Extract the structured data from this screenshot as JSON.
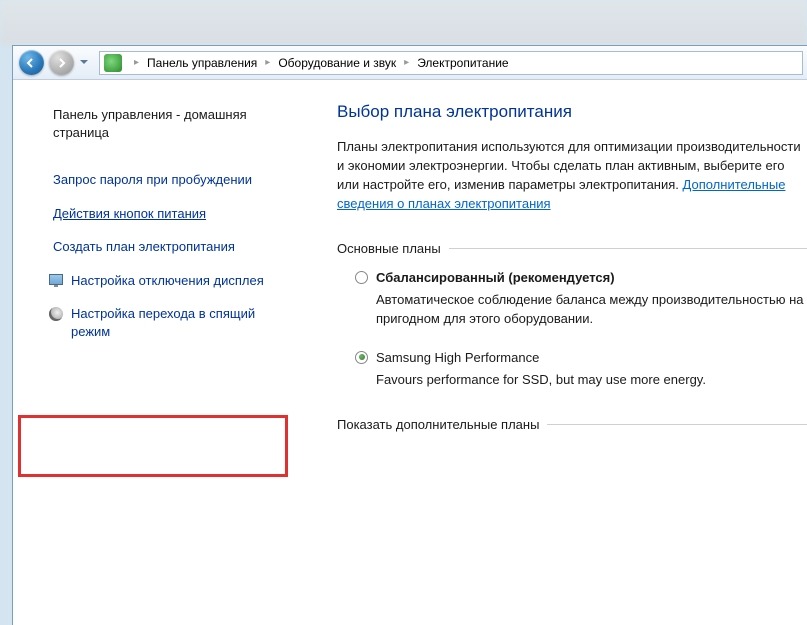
{
  "breadcrumb": {
    "parts": [
      "Панель управления",
      "Оборудование и звук",
      "Электропитание"
    ]
  },
  "sidebar": {
    "home": "Панель управления - домашняя страница",
    "items": [
      {
        "label": "Запрос пароля при пробуждении"
      },
      {
        "label": "Действия кнопок питания"
      },
      {
        "label": "Создать план электропитания"
      },
      {
        "label": "Настройка отключения дисплея"
      },
      {
        "label": "Настройка перехода в спящий режим"
      }
    ]
  },
  "main": {
    "title": "Выбор плана электропитания",
    "desc_part1": "Планы электропитания используются для оптимизации производительности и экономии электроэнергии. Чтобы сделать план активным, выберите его или настройте его, изменив параметры электропитания. ",
    "desc_link": "Дополнительные сведения о планах электропитания",
    "section1_label": "Основные планы",
    "plan1": {
      "name": "Сбалансированный (рекомендуется)",
      "desc": "Автоматическое соблюдение баланса между производительностью на пригодном для этого оборудовании."
    },
    "plan2": {
      "name": "Samsung High Performance",
      "desc": "Favours performance for SSD, but may use more energy."
    },
    "section2_label": "Показать дополнительные планы"
  }
}
